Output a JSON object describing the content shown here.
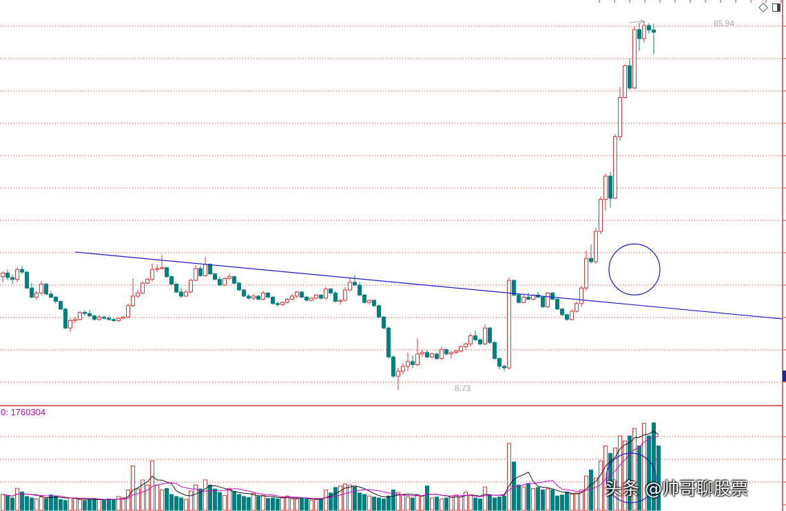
{
  "chart_data": [
    {
      "type": "candlestick",
      "panel": "price",
      "annotations": {
        "high_label": "85.94",
        "low_label": "8.73"
      },
      "gridlines": "dotted-red",
      "trendline": {
        "color": "#1a1acc",
        "description": "descending resistance line",
        "from": {
          "index": 15,
          "price": 20.5
        },
        "to": {
          "index": 145,
          "price": 14.2
        }
      },
      "highlight_circle": {
        "center_index": 131,
        "center_price": 18.4
      },
      "ohlc": [
        [
          17.6,
          18.2,
          17.0,
          18.0
        ],
        [
          18.0,
          18.4,
          17.2,
          17.5
        ],
        [
          17.5,
          17.8,
          16.8,
          17.3
        ],
        [
          17.3,
          18.6,
          17.0,
          18.4
        ],
        [
          18.4,
          18.8,
          17.9,
          18.1
        ],
        [
          18.1,
          18.2,
          16.3,
          16.4
        ],
        [
          16.4,
          16.9,
          15.4,
          15.5
        ],
        [
          15.5,
          16.1,
          15.2,
          15.9
        ],
        [
          15.9,
          17.1,
          15.7,
          16.8
        ],
        [
          16.8,
          16.9,
          15.7,
          15.8
        ],
        [
          15.8,
          16.1,
          15.4,
          15.5
        ],
        [
          15.5,
          15.6,
          14.9,
          15.1
        ],
        [
          15.1,
          15.2,
          14.3,
          14.4
        ],
        [
          14.4,
          14.5,
          12.7,
          12.8
        ],
        [
          12.8,
          13.6,
          12.5,
          13.4
        ],
        [
          13.4,
          13.7,
          13.2,
          13.5
        ],
        [
          13.5,
          14.2,
          13.4,
          14.1
        ],
        [
          14.1,
          14.3,
          13.8,
          14.0
        ],
        [
          14.0,
          14.3,
          13.7,
          13.8
        ],
        [
          13.8,
          13.9,
          13.4,
          13.5
        ],
        [
          13.5,
          13.9,
          13.4,
          13.7
        ],
        [
          13.7,
          13.8,
          13.5,
          13.6
        ],
        [
          13.6,
          13.8,
          13.4,
          13.5
        ],
        [
          13.5,
          13.6,
          13.3,
          13.4
        ],
        [
          13.4,
          13.7,
          13.3,
          13.6
        ],
        [
          13.6,
          13.8,
          13.5,
          13.7
        ],
        [
          13.7,
          14.9,
          13.6,
          14.7
        ],
        [
          14.7,
          17.4,
          14.6,
          15.6
        ],
        [
          15.6,
          16.2,
          15.4,
          15.9
        ],
        [
          15.9,
          17.1,
          15.8,
          16.9
        ],
        [
          16.9,
          17.5,
          16.8,
          17.3
        ],
        [
          17.3,
          19.1,
          17.1,
          18.4
        ],
        [
          18.4,
          19.0,
          18.1,
          18.5
        ],
        [
          18.5,
          20.1,
          18.4,
          18.6
        ],
        [
          18.6,
          18.7,
          17.5,
          17.6
        ],
        [
          17.6,
          17.7,
          16.7,
          16.8
        ],
        [
          16.8,
          16.9,
          15.9,
          16.0
        ],
        [
          16.0,
          16.4,
          15.4,
          15.6
        ],
        [
          15.6,
          16.2,
          15.5,
          16.0
        ],
        [
          16.0,
          17.4,
          15.9,
          17.2
        ],
        [
          17.2,
          18.9,
          17.1,
          18.5
        ],
        [
          18.5,
          18.8,
          17.6,
          17.7
        ],
        [
          17.7,
          19.9,
          17.6,
          19.0
        ],
        [
          19.0,
          19.1,
          17.8,
          17.9
        ],
        [
          17.9,
          18.0,
          17.2,
          17.3
        ],
        [
          17.3,
          17.6,
          16.6,
          16.7
        ],
        [
          16.7,
          17.5,
          16.6,
          17.4
        ],
        [
          17.4,
          17.9,
          17.3,
          17.6
        ],
        [
          17.6,
          17.7,
          16.8,
          16.9
        ],
        [
          16.9,
          17.0,
          16.1,
          16.2
        ],
        [
          16.2,
          16.3,
          15.5,
          15.6
        ],
        [
          15.6,
          15.8,
          15.3,
          15.4
        ],
        [
          15.4,
          15.8,
          15.2,
          15.6
        ],
        [
          15.6,
          15.7,
          15.2,
          15.3
        ],
        [
          15.3,
          16.1,
          15.2,
          15.9
        ],
        [
          15.9,
          16.0,
          15.4,
          15.5
        ],
        [
          15.5,
          15.6,
          14.8,
          14.9
        ],
        [
          14.9,
          15.1,
          14.6,
          14.8
        ],
        [
          14.8,
          15.1,
          14.7,
          15.0
        ],
        [
          15.0,
          15.4,
          14.9,
          15.3
        ],
        [
          15.3,
          15.8,
          15.2,
          15.6
        ],
        [
          15.6,
          16.1,
          15.4,
          16.0
        ],
        [
          16.0,
          16.1,
          15.4,
          15.5
        ],
        [
          15.5,
          15.6,
          15.1,
          15.2
        ],
        [
          15.2,
          15.5,
          15.1,
          15.4
        ],
        [
          15.4,
          15.8,
          15.3,
          15.7
        ],
        [
          15.7,
          15.8,
          15.3,
          15.4
        ],
        [
          15.4,
          16.5,
          15.3,
          16.3
        ],
        [
          16.3,
          16.4,
          15.8,
          15.9
        ],
        [
          15.9,
          16.1,
          15.0,
          15.1
        ],
        [
          15.1,
          15.3,
          14.8,
          15.2
        ],
        [
          15.2,
          16.5,
          15.1,
          16.2
        ],
        [
          16.2,
          17.4,
          16.1,
          17.0
        ],
        [
          17.0,
          17.8,
          16.6,
          16.7
        ],
        [
          16.7,
          17.0,
          15.6,
          15.7
        ],
        [
          15.7,
          15.8,
          14.9,
          15.0
        ],
        [
          15.0,
          15.3,
          14.8,
          15.2
        ],
        [
          15.2,
          15.3,
          14.6,
          14.7
        ],
        [
          14.7,
          14.8,
          13.6,
          13.7
        ],
        [
          13.7,
          13.8,
          12.7,
          12.8
        ],
        [
          12.8,
          12.9,
          10.6,
          10.7
        ],
        [
          10.7,
          10.8,
          9.4,
          9.5
        ],
        [
          9.5,
          10.0,
          8.73,
          9.8
        ],
        [
          9.8,
          10.3,
          9.6,
          10.1
        ],
        [
          10.1,
          11.0,
          9.8,
          10.4
        ],
        [
          10.4,
          10.8,
          10.0,
          10.2
        ],
        [
          10.2,
          12.0,
          10.1,
          10.9
        ],
        [
          10.9,
          11.2,
          10.7,
          11.0
        ],
        [
          11.0,
          11.2,
          10.6,
          10.7
        ],
        [
          10.7,
          11.0,
          10.6,
          10.9
        ],
        [
          10.9,
          11.0,
          10.5,
          10.6
        ],
        [
          10.6,
          11.4,
          10.5,
          11.2
        ],
        [
          11.2,
          11.3,
          10.8,
          10.9
        ],
        [
          10.9,
          11.1,
          10.6,
          11.0
        ],
        [
          11.0,
          11.2,
          10.9,
          11.1
        ],
        [
          11.1,
          11.5,
          11.0,
          11.4
        ],
        [
          11.4,
          11.7,
          11.2,
          11.6
        ],
        [
          11.6,
          12.4,
          11.4,
          12.2
        ],
        [
          12.2,
          12.6,
          11.8,
          11.9
        ],
        [
          11.9,
          12.0,
          11.5,
          11.6
        ],
        [
          11.6,
          13.1,
          11.5,
          12.8
        ],
        [
          12.8,
          12.9,
          11.6,
          11.7
        ],
        [
          11.7,
          11.8,
          10.5,
          10.6
        ],
        [
          10.6,
          10.7,
          9.9,
          10.1
        ],
        [
          10.1,
          10.2,
          9.8,
          10.0
        ],
        [
          10.0,
          17.5,
          9.9,
          17.2
        ],
        [
          17.2,
          17.3,
          15.6,
          15.7
        ],
        [
          15.7,
          15.8,
          14.9,
          15.0
        ],
        [
          15.0,
          15.7,
          14.9,
          15.5
        ],
        [
          15.5,
          15.9,
          15.2,
          15.3
        ],
        [
          15.3,
          15.8,
          15.2,
          15.7
        ],
        [
          15.7,
          16.0,
          15.4,
          15.5
        ],
        [
          15.5,
          15.6,
          14.5,
          14.6
        ],
        [
          14.6,
          16.0,
          14.5,
          15.9
        ],
        [
          15.9,
          16.0,
          15.2,
          15.3
        ],
        [
          15.3,
          15.4,
          14.3,
          14.4
        ],
        [
          14.4,
          14.5,
          13.8,
          13.9
        ],
        [
          13.9,
          14.0,
          13.4,
          13.5
        ],
        [
          13.5,
          14.4,
          13.4,
          14.2
        ],
        [
          14.2,
          15.1,
          14.1,
          14.9
        ],
        [
          14.9,
          16.6,
          14.6,
          16.4
        ],
        [
          16.4,
          20.7,
          16.1,
          19.7
        ],
        [
          19.7,
          21.5,
          19.1,
          19.3
        ],
        [
          19.3,
          23.8,
          19.1,
          23.3
        ],
        [
          23.3,
          28.9,
          22.9,
          28.4
        ],
        [
          28.4,
          33.3,
          26.5,
          32.8
        ],
        [
          32.8,
          33.6,
          27.0,
          28.6
        ],
        [
          28.6,
          42.5,
          28.5,
          41.9
        ],
        [
          41.9,
          56.9,
          40.9,
          53.4
        ],
        [
          53.4,
          65.5,
          53.0,
          65.0
        ],
        [
          65.0,
          68.1,
          55.9,
          56.6
        ],
        [
          56.6,
          83.2,
          56.2,
          81.3
        ],
        [
          81.3,
          84.6,
          71.3,
          76.9
        ],
        [
          76.9,
          85.94,
          75.0,
          83.4
        ],
        [
          83.4,
          84.6,
          79.4,
          81.1
        ],
        [
          81.1,
          84.3,
          69.9,
          80.0
        ]
      ]
    },
    {
      "type": "bar",
      "panel": "volume",
      "label": "0: 1760304",
      "series_colors": {
        "up": "#e03030",
        "down": "#008080",
        "ma_short": "#101010",
        "ma_long": "#cc00cc"
      },
      "volume_peak": 1760304,
      "highlight_circle": {
        "center_index": 131
      },
      "values": [
        330000,
        300000,
        260000,
        450000,
        380000,
        290000,
        260000,
        240000,
        280000,
        250000,
        320000,
        290000,
        230000,
        210000,
        260000,
        260000,
        230000,
        210000,
        220000,
        250000,
        230000,
        210000,
        240000,
        220000,
        290000,
        260000,
        420000,
        900000,
        440000,
        620000,
        520000,
        1000000,
        520000,
        420000,
        450000,
        330000,
        290000,
        260000,
        230000,
        400000,
        520000,
        440000,
        620000,
        520000,
        440000,
        370000,
        310000,
        450000,
        390000,
        330000,
        290000,
        270000,
        350000,
        290000,
        310000,
        250000,
        260000,
        240000,
        270000,
        300000,
        240000,
        240000,
        260000,
        240000,
        210000,
        230000,
        250000,
        420000,
        360000,
        470000,
        500000,
        540000,
        520000,
        480000,
        360000,
        330000,
        300000,
        280000,
        260000,
        240000,
        300000,
        420000,
        370000,
        320000,
        280000,
        260000,
        330000,
        300000,
        500000,
        260000,
        280000,
        240000,
        260000,
        300000,
        320000,
        280000,
        380000,
        320000,
        260000,
        240000,
        480000,
        320000,
        260000,
        280000,
        300000,
        1350000,
        980000,
        520000,
        480000,
        550000,
        450000,
        470000,
        420000,
        440000,
        420000,
        300000,
        320000,
        380000,
        340000,
        360000,
        420000,
        700000,
        820000,
        660000,
        1000000,
        1300000,
        1150000,
        1260000,
        1500000,
        1400000,
        1500000,
        1650000,
        1300000,
        1750000,
        1500000,
        1760304,
        1300000
      ]
    }
  ],
  "watermark": "头条 @帅哥聊股票"
}
